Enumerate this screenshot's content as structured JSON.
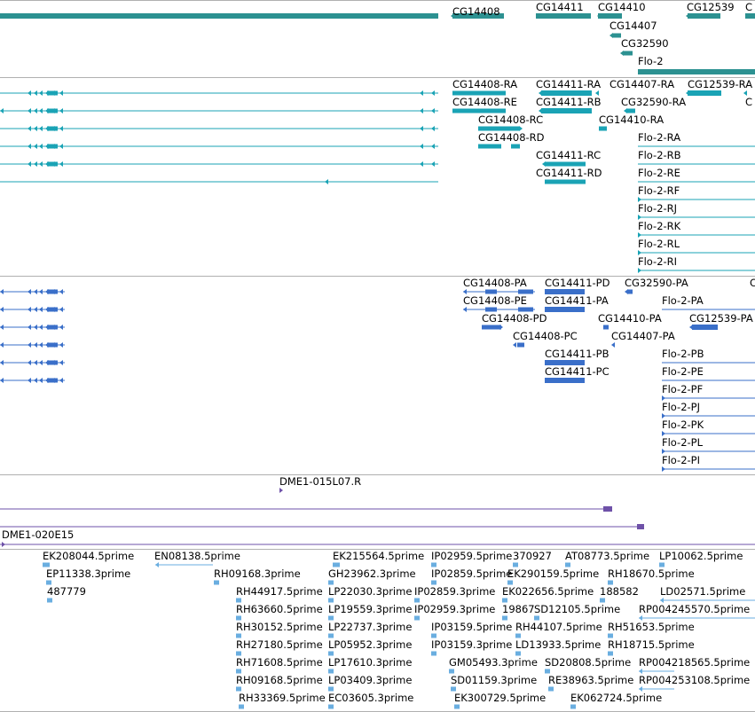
{
  "colors": {
    "gene": "#2c9191",
    "transcript": "#1aa3b5",
    "protein": "#3a6fc9",
    "clone": "#6e51a8",
    "est": "#6aaee0",
    "separator": "#b0b0b0"
  },
  "genes": [
    {
      "label": "CG14408"
    },
    {
      "label": "CG14411"
    },
    {
      "label": "CG14410"
    },
    {
      "label": "CG12539"
    },
    {
      "label": "C"
    },
    {
      "label": "CG14407"
    },
    {
      "label": "CG32590"
    },
    {
      "label": "Flo-2"
    }
  ],
  "transcripts": [
    {
      "label": "CG14408-RA"
    },
    {
      "label": "CG14411-RA"
    },
    {
      "label": "CG14407-RA"
    },
    {
      "label": "CG12539-RA"
    },
    {
      "label": "CG14408-RE"
    },
    {
      "label": "CG14411-RB"
    },
    {
      "label": "CG32590-RA"
    },
    {
      "label": "C"
    },
    {
      "label": "CG14408-RC"
    },
    {
      "label": "CG14410-RA"
    },
    {
      "label": "CG14408-RD"
    },
    {
      "label": "Flo-2-RA"
    },
    {
      "label": "Flo-2-RB"
    },
    {
      "label": "CG14411-RC"
    },
    {
      "label": "CG14411-RD"
    },
    {
      "label": "Flo-2-RE"
    },
    {
      "label": "Flo-2-RF"
    },
    {
      "label": "Flo-2-RJ"
    },
    {
      "label": "Flo-2-RK"
    },
    {
      "label": "Flo-2-RL"
    },
    {
      "label": "Flo-2-RI"
    }
  ],
  "proteins": [
    {
      "label": "CG14408-PA"
    },
    {
      "label": "CG14411-PD"
    },
    {
      "label": "CG32590-PA"
    },
    {
      "label": "C"
    },
    {
      "label": "CG14408-PE"
    },
    {
      "label": "CG14411-PA"
    },
    {
      "label": "Flo-2-PA"
    },
    {
      "label": "CG14408-PD"
    },
    {
      "label": "CG14410-PA"
    },
    {
      "label": "CG12539-PA"
    },
    {
      "label": "CG14408-PC"
    },
    {
      "label": "CG14407-PA"
    },
    {
      "label": "CG14411-PB"
    },
    {
      "label": "Flo-2-PB"
    },
    {
      "label": "CG14411-PC"
    },
    {
      "label": "Flo-2-PE"
    },
    {
      "label": "Flo-2-PF"
    },
    {
      "label": "Flo-2-PJ"
    },
    {
      "label": "Flo-2-PK"
    },
    {
      "label": "Flo-2-PL"
    },
    {
      "label": "Flo-2-PI"
    }
  ],
  "clones": [
    {
      "label": "DME1-015L07.R"
    },
    {
      "label": "DME1-020E15"
    }
  ],
  "ests": [
    {
      "label": "EK208044.5prime"
    },
    {
      "label": "EN08138.5prime"
    },
    {
      "label": "EK215564.5prime"
    },
    {
      "label": "IP02959.5prime"
    },
    {
      "label": "370927"
    },
    {
      "label": "AT08773.5prime"
    },
    {
      "label": "LP10062.5prime"
    },
    {
      "label": "EP11338.3prime"
    },
    {
      "label": "RH09168.3prime"
    },
    {
      "label": "GH23962.3prime"
    },
    {
      "label": "IP02859.5prime"
    },
    {
      "label": "EK290159.5prime"
    },
    {
      "label": "RH18670.5prime"
    },
    {
      "label": "487779"
    },
    {
      "label": "RH44917.5prime"
    },
    {
      "label": "LP22030.3prime"
    },
    {
      "label": "IP02859.3prime"
    },
    {
      "label": "EK022656.5prime"
    },
    {
      "label": "188582"
    },
    {
      "label": "LD02571.5prime"
    },
    {
      "label": "RH63660.5prime"
    },
    {
      "label": "LP19559.3prime"
    },
    {
      "label": "IP02959.3prime"
    },
    {
      "label": "19867"
    },
    {
      "label": "SD12105.5prime"
    },
    {
      "label": "RP004245570.5prime"
    },
    {
      "label": "RH30152.5prime"
    },
    {
      "label": "LP22737.3prime"
    },
    {
      "label": "IP03159.5prime"
    },
    {
      "label": "RH44107.5prime"
    },
    {
      "label": "RH51653.5prime"
    },
    {
      "label": "RH27180.5prime"
    },
    {
      "label": "LP05952.3prime"
    },
    {
      "label": "IP03159.3prime"
    },
    {
      "label": "LD13933.5prime"
    },
    {
      "label": "RH18715.5prime"
    },
    {
      "label": "RH71608.5prime"
    },
    {
      "label": "LP17610.3prime"
    },
    {
      "label": "GM05493.3prime"
    },
    {
      "label": "SD20808.5prime"
    },
    {
      "label": "RP004218565.5prime"
    },
    {
      "label": "RH09168.5prime"
    },
    {
      "label": "LP03409.3prime"
    },
    {
      "label": "SD01159.3prime"
    },
    {
      "label": "RE38963.5prime"
    },
    {
      "label": "RP004253108.5prime"
    },
    {
      "label": "RH33369.5prime"
    },
    {
      "label": "EC03605.3prime"
    },
    {
      "label": "EK300729.5prime"
    },
    {
      "label": "EK062724.5prime"
    }
  ]
}
